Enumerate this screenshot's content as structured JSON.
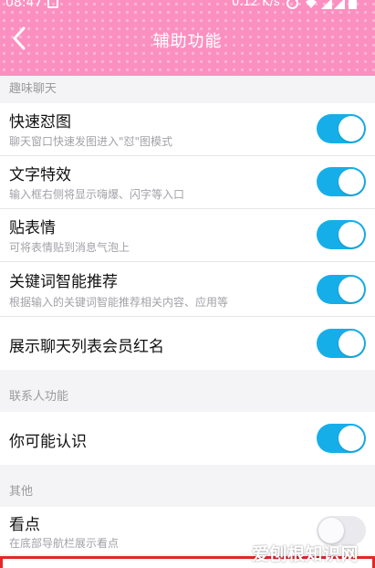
{
  "status_bar": {
    "time": "08:47",
    "network_speed": "0.12 K/s"
  },
  "header": {
    "title": "辅助功能",
    "back_icon": "chevron-left-icon"
  },
  "colors": {
    "header_bg": "#fb8fc0",
    "toggle_on": "#16aee9",
    "highlight_box": "#e0282a"
  },
  "sections": [
    {
      "header": "趣味聊天",
      "items": [
        {
          "title": "快速怼图",
          "subtitle": "聊天窗口快速发图进入\"怼\"图模式",
          "enabled": true
        },
        {
          "title": "文字特效",
          "subtitle": "输入框右侧将显示嗨爆、闪字等入口",
          "enabled": true
        },
        {
          "title": "贴表情",
          "subtitle": "可将表情贴到消息气泡上",
          "enabled": true
        },
        {
          "title": "关键词智能推荐",
          "subtitle": "根据输入的关键词智能推荐相关内容、应用等",
          "enabled": true
        },
        {
          "title": "展示聊天列表会员红名",
          "subtitle": "",
          "enabled": true
        }
      ]
    },
    {
      "header": "联系人功能",
      "items": [
        {
          "title": "你可能认识",
          "subtitle": "",
          "enabled": true
        }
      ]
    },
    {
      "header": "其他",
      "items": [
        {
          "title": "看点",
          "subtitle": "在底部导航栏展示看点",
          "enabled": false
        }
      ]
    }
  ],
  "watermark": "爱刨根知识网"
}
